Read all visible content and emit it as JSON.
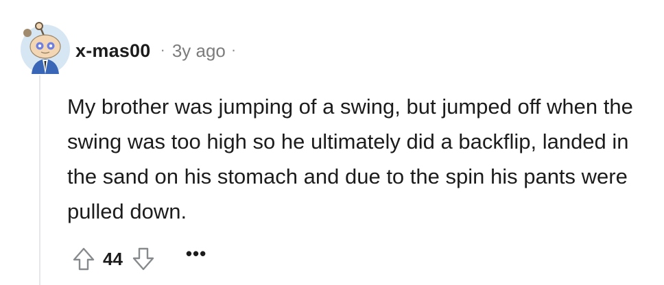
{
  "comment": {
    "username": "x-mas00",
    "timestamp": "3y ago",
    "separator": "·",
    "body": "My brother was jumping of a swing, but jumped off when the swing was too high so he ultimately did a backflip, landed in the sand on his stomach and due to the spin his pants were pulled down.",
    "score": "44",
    "more_label": "•••",
    "upvote_icon": "arrow-up-outline-icon",
    "downvote_icon": "arrow-down-outline-icon",
    "avatar_icon": "snoo-avatar"
  },
  "colors": {
    "text": "#1c1c1c",
    "meta": "#7c7c7c",
    "thread_line": "#e5e7e9",
    "avatar_bg": "#c9dff0",
    "avatar_suit": "#3a66b8"
  }
}
